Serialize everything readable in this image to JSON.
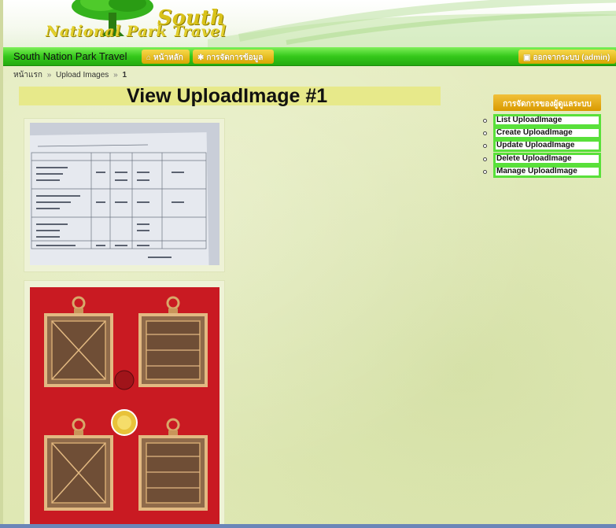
{
  "logo": {
    "line1": "South",
    "line2": "National Park Travel"
  },
  "navbar": {
    "brand": "South Nation Park Travel",
    "home_label": "หน้าหลัก",
    "manage_label": "การจัดการข้อมูล",
    "logout_label": "ออกจากระบบ (admin)"
  },
  "breadcrumb": {
    "home": "หน้าแรก",
    "section": "Upload Images",
    "current": "1",
    "separator": "»"
  },
  "page": {
    "title": "View UploadImage #1"
  },
  "sidebar": {
    "header": "การจัดการของผู้ดูแลระบบ",
    "items": [
      {
        "label": "List UploadImage"
      },
      {
        "label": "Create UploadImage"
      },
      {
        "label": "Update UploadImage"
      },
      {
        "label": "Delete UploadImage"
      },
      {
        "label": "Manage UploadImage"
      }
    ]
  },
  "images": [
    {
      "description": "photo-of-price-table-document"
    },
    {
      "description": "photo-of-four-square-amulets-on-red"
    }
  ],
  "colors": {
    "nav_green": "#35c81b",
    "button_gold": "#d7a600",
    "title_bar": "#e7e98a",
    "sidebar_border": "#59e03a",
    "amulet_background": "#c91a22"
  }
}
